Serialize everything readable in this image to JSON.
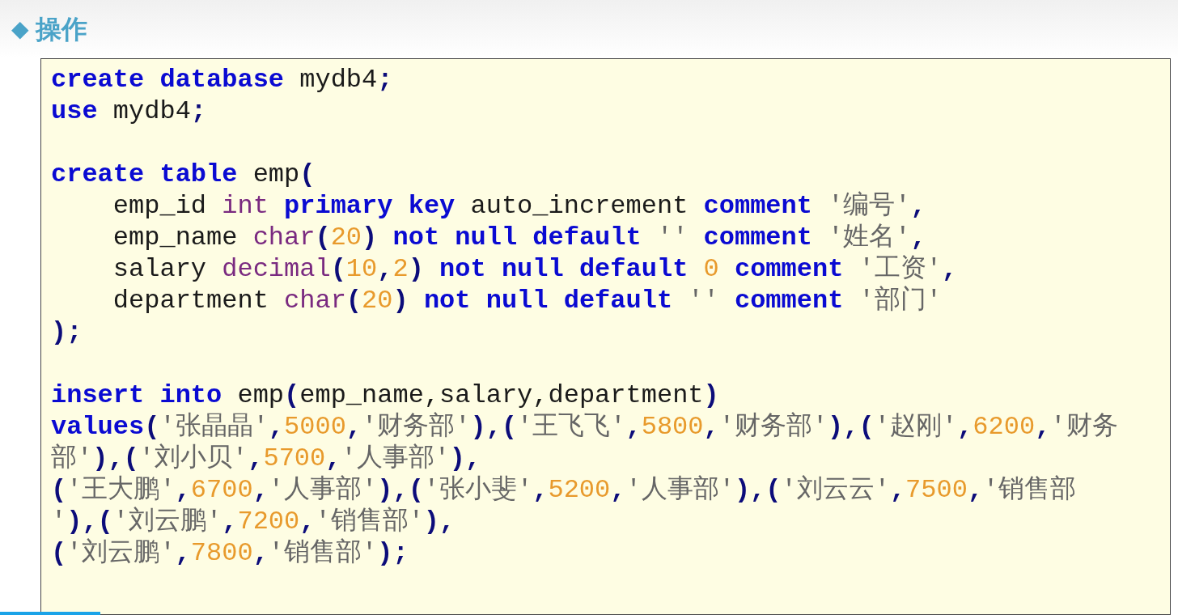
{
  "heading": {
    "bullet": "◆",
    "title": "操作"
  },
  "code_blocks": [
    {
      "lines": [
        [
          {
            "kind": "kw",
            "text": "create database"
          },
          {
            "kind": "plain",
            "text": " mydb4"
          },
          {
            "kind": "punct",
            "text": ";"
          }
        ],
        [
          {
            "kind": "kw",
            "text": "use"
          },
          {
            "kind": "plain",
            "text": " mydb4"
          },
          {
            "kind": "punct",
            "text": ";"
          }
        ]
      ]
    },
    {
      "lines": [
        [
          {
            "kind": "kw",
            "text": "create table"
          },
          {
            "kind": "plain",
            "text": " emp"
          },
          {
            "kind": "punct",
            "text": "("
          }
        ],
        [
          {
            "kind": "plain",
            "text": "    emp_id "
          },
          {
            "kind": "type",
            "text": "int"
          },
          {
            "kind": "kw",
            "text": " primary key"
          },
          {
            "kind": "plain",
            "text": " auto_increment "
          },
          {
            "kind": "kw",
            "text": "comment"
          },
          {
            "kind": "str",
            "text": " '编号'"
          },
          {
            "kind": "punct",
            "text": ","
          }
        ],
        [
          {
            "kind": "plain",
            "text": "    emp_name "
          },
          {
            "kind": "type",
            "text": "char"
          },
          {
            "kind": "punct",
            "text": "("
          },
          {
            "kind": "num",
            "text": "20"
          },
          {
            "kind": "punct",
            "text": ")"
          },
          {
            "kind": "kw",
            "text": " not null default"
          },
          {
            "kind": "str",
            "text": " '' "
          },
          {
            "kind": "kw",
            "text": "comment"
          },
          {
            "kind": "str",
            "text": " '姓名'"
          },
          {
            "kind": "punct",
            "text": ","
          }
        ],
        [
          {
            "kind": "plain",
            "text": "    salary "
          },
          {
            "kind": "type",
            "text": "decimal"
          },
          {
            "kind": "punct",
            "text": "("
          },
          {
            "kind": "num",
            "text": "10"
          },
          {
            "kind": "punct",
            "text": ","
          },
          {
            "kind": "num",
            "text": "2"
          },
          {
            "kind": "punct",
            "text": ")"
          },
          {
            "kind": "kw",
            "text": " not null default"
          },
          {
            "kind": "num",
            "text": " 0 "
          },
          {
            "kind": "kw",
            "text": "comment"
          },
          {
            "kind": "str",
            "text": " '工资'"
          },
          {
            "kind": "punct",
            "text": ","
          }
        ],
        [
          {
            "kind": "plain",
            "text": "    department "
          },
          {
            "kind": "type",
            "text": "char"
          },
          {
            "kind": "punct",
            "text": "("
          },
          {
            "kind": "num",
            "text": "20"
          },
          {
            "kind": "punct",
            "text": ")"
          },
          {
            "kind": "kw",
            "text": " not null default"
          },
          {
            "kind": "str",
            "text": " '' "
          },
          {
            "kind": "kw",
            "text": "comment"
          },
          {
            "kind": "str",
            "text": " '部门'"
          }
        ],
        [
          {
            "kind": "punct",
            "text": ");"
          }
        ]
      ]
    },
    {
      "lines": [
        [
          {
            "kind": "kw",
            "text": "insert into"
          },
          {
            "kind": "plain",
            "text": " emp"
          },
          {
            "kind": "punct",
            "text": "("
          },
          {
            "kind": "plain",
            "text": "emp_name,salary,department"
          },
          {
            "kind": "punct",
            "text": ")"
          }
        ],
        [
          {
            "kind": "kw",
            "text": "values"
          },
          {
            "kind": "punct",
            "text": "("
          },
          {
            "kind": "str",
            "text": "'张晶晶'"
          },
          {
            "kind": "punct",
            "text": ","
          },
          {
            "kind": "num",
            "text": "5000"
          },
          {
            "kind": "punct",
            "text": ","
          },
          {
            "kind": "str",
            "text": "'财务部'"
          },
          {
            "kind": "punct",
            "text": "),("
          },
          {
            "kind": "str",
            "text": "'王飞飞'"
          },
          {
            "kind": "punct",
            "text": ","
          },
          {
            "kind": "num",
            "text": "5800"
          },
          {
            "kind": "punct",
            "text": ","
          },
          {
            "kind": "str",
            "text": "'财务部'"
          },
          {
            "kind": "punct",
            "text": "),("
          },
          {
            "kind": "str",
            "text": "'赵刚'"
          },
          {
            "kind": "punct",
            "text": ","
          },
          {
            "kind": "num",
            "text": "6200"
          },
          {
            "kind": "punct",
            "text": ","
          },
          {
            "kind": "str",
            "text": "'财务"
          }
        ],
        [
          {
            "kind": "str",
            "text": "部'"
          },
          {
            "kind": "punct",
            "text": "),("
          },
          {
            "kind": "str",
            "text": "'刘小贝'"
          },
          {
            "kind": "punct",
            "text": ","
          },
          {
            "kind": "num",
            "text": "5700"
          },
          {
            "kind": "punct",
            "text": ","
          },
          {
            "kind": "str",
            "text": "'人事部'"
          },
          {
            "kind": "punct",
            "text": "),"
          }
        ],
        [
          {
            "kind": "punct",
            "text": "("
          },
          {
            "kind": "str",
            "text": "'王大鹏'"
          },
          {
            "kind": "punct",
            "text": ","
          },
          {
            "kind": "num",
            "text": "6700"
          },
          {
            "kind": "punct",
            "text": ","
          },
          {
            "kind": "str",
            "text": "'人事部'"
          },
          {
            "kind": "punct",
            "text": "),("
          },
          {
            "kind": "str",
            "text": "'张小斐'"
          },
          {
            "kind": "punct",
            "text": ","
          },
          {
            "kind": "num",
            "text": "5200"
          },
          {
            "kind": "punct",
            "text": ","
          },
          {
            "kind": "str",
            "text": "'人事部'"
          },
          {
            "kind": "punct",
            "text": "),("
          },
          {
            "kind": "str",
            "text": "'刘云云'"
          },
          {
            "kind": "punct",
            "text": ","
          },
          {
            "kind": "num",
            "text": "7500"
          },
          {
            "kind": "punct",
            "text": ","
          },
          {
            "kind": "str",
            "text": "'销售部"
          }
        ],
        [
          {
            "kind": "str",
            "text": "'"
          },
          {
            "kind": "punct",
            "text": "),("
          },
          {
            "kind": "str",
            "text": "'刘云鹏'"
          },
          {
            "kind": "punct",
            "text": ","
          },
          {
            "kind": "num",
            "text": "7200"
          },
          {
            "kind": "punct",
            "text": ","
          },
          {
            "kind": "str",
            "text": "'销售部'"
          },
          {
            "kind": "punct",
            "text": "),"
          }
        ],
        [
          {
            "kind": "punct",
            "text": "("
          },
          {
            "kind": "str",
            "text": "'刘云鹏'"
          },
          {
            "kind": "punct",
            "text": ","
          },
          {
            "kind": "num",
            "text": "7800"
          },
          {
            "kind": "punct",
            "text": ","
          },
          {
            "kind": "str",
            "text": "'销售部'"
          },
          {
            "kind": "punct",
            "text": ");"
          }
        ]
      ]
    }
  ],
  "playback": {
    "level": 0.085
  }
}
